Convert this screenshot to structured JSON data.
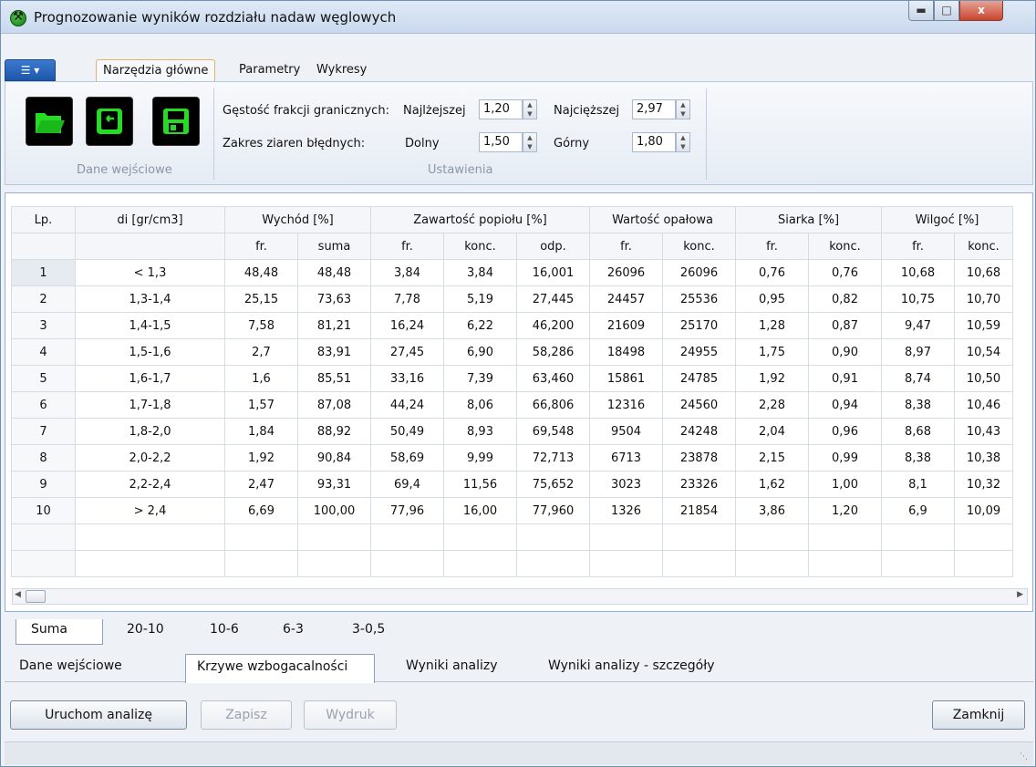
{
  "window": {
    "title": "Prognozowanie wyników rozdziału nadaw węglowych",
    "close_label": "x"
  },
  "ribbon": {
    "app_menu_icon": "list-icon",
    "tabs": [
      "Narzędzia główne",
      "Parametry",
      "Wykresy"
    ],
    "active_tab": "Narzędzia główne",
    "groups": {
      "input": {
        "label": "Dane wejściowe",
        "buttons": [
          {
            "icon": "folder-open-icon",
            "color": "#22dd22"
          },
          {
            "icon": "import-icon",
            "color": "#22dd22"
          },
          {
            "icon": "save-icon",
            "color": "#22dd22"
          }
        ]
      },
      "settings": {
        "label": "Ustawienia",
        "density_label": "Gęstość frakcji granicznych:",
        "lightest_label": "Najlżejszej",
        "lightest_value": "1,20",
        "heaviest_label": "Najcięższej",
        "heaviest_value": "2,97",
        "grain_label": "Zakres ziaren błędnych:",
        "lower_label": "Dolny",
        "lower_value": "1,50",
        "upper_label": "Górny",
        "upper_value": "1,80"
      }
    }
  },
  "table": {
    "header1": {
      "lp": "Lp.",
      "di": "di [gr/cm3]",
      "yield": "Wychód [%]",
      "ash": "Zawartość popiołu [%]",
      "calorific": "Wartość opałowa",
      "sulfur": "Siarka [%]",
      "moisture": "Wilgoć [%]"
    },
    "header2": [
      "fr.",
      "suma",
      "fr.",
      "konc.",
      "odp.",
      "fr.",
      "konc.",
      "fr.",
      "konc.",
      "fr.",
      "konc."
    ],
    "rows": [
      [
        "1",
        "< 1,3",
        "48,48",
        "48,48",
        "3,84",
        "3,84",
        "16,001",
        "26096",
        "26096",
        "0,76",
        "0,76",
        "10,68",
        "10,68"
      ],
      [
        "2",
        "1,3-1,4",
        "25,15",
        "73,63",
        "7,78",
        "5,19",
        "27,445",
        "24457",
        "25536",
        "0,95",
        "0,82",
        "10,75",
        "10,70"
      ],
      [
        "3",
        "1,4-1,5",
        "7,58",
        "81,21",
        "16,24",
        "6,22",
        "46,200",
        "21609",
        "25170",
        "1,28",
        "0,87",
        "9,47",
        "10,59"
      ],
      [
        "4",
        "1,5-1,6",
        "2,7",
        "83,91",
        "27,45",
        "6,90",
        "58,286",
        "18498",
        "24955",
        "1,75",
        "0,90",
        "8,97",
        "10,54"
      ],
      [
        "5",
        "1,6-1,7",
        "1,6",
        "85,51",
        "33,16",
        "7,39",
        "63,460",
        "15861",
        "24785",
        "1,92",
        "0,91",
        "8,74",
        "10,50"
      ],
      [
        "6",
        "1,7-1,8",
        "1,57",
        "87,08",
        "44,24",
        "8,06",
        "66,806",
        "12316",
        "24560",
        "2,28",
        "0,94",
        "8,38",
        "10,46"
      ],
      [
        "7",
        "1,8-2,0",
        "1,84",
        "88,92",
        "50,49",
        "8,93",
        "69,548",
        "9504",
        "24248",
        "2,04",
        "0,96",
        "8,68",
        "10,43"
      ],
      [
        "8",
        "2,0-2,2",
        "1,92",
        "90,84",
        "58,69",
        "9,99",
        "72,713",
        "6713",
        "23878",
        "2,15",
        "0,99",
        "8,38",
        "10,38"
      ],
      [
        "9",
        "2,2-2,4",
        "2,47",
        "93,31",
        "69,4",
        "11,56",
        "75,652",
        "3023",
        "23326",
        "1,62",
        "1,00",
        "8,1",
        "10,32"
      ],
      [
        "10",
        "> 2,4",
        "6,69",
        "100,00",
        "77,96",
        "16,00",
        "77,960",
        "1326",
        "21854",
        "3,86",
        "1,20",
        "6,9",
        "10,09"
      ]
    ]
  },
  "size_tabs": [
    "Suma",
    "20-10",
    "10-6",
    "6-3",
    "3-0,5"
  ],
  "bottom_tabs": [
    "Dane wejściowe",
    "Krzywe wzbogacalności",
    "Wyniki analizy",
    "Wyniki analizy - szczegóły"
  ],
  "buttons": {
    "run": "Uruchom analizę",
    "save": "Zapisz",
    "print": "Wydruk",
    "close": "Zamknij"
  }
}
